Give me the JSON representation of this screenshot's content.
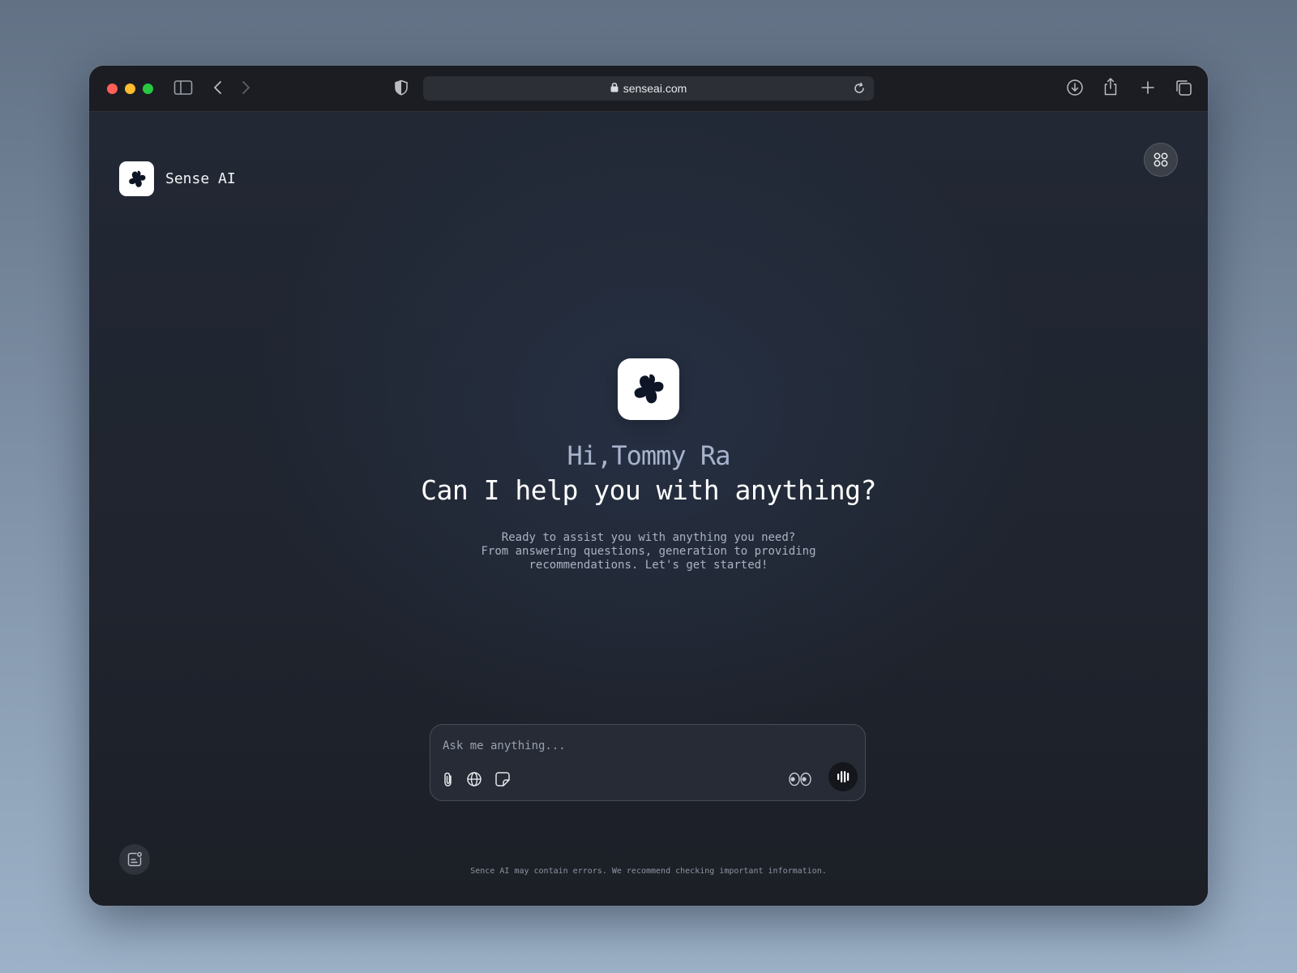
{
  "browser": {
    "url": "senseai.com",
    "icons": {
      "sidebar": "sidebar-icon",
      "back": "chevron-left-icon",
      "forward": "chevron-right-icon",
      "privacy": "shield-icon",
      "lock": "lock-icon",
      "reload": "reload-icon",
      "download": "download-icon",
      "share": "share-icon",
      "new_tab": "plus-icon",
      "tabs": "tabs-overview-icon"
    }
  },
  "app": {
    "brand_name": "Sense AI",
    "greeting_name": "Hi,Tommy Ra",
    "headline": "Can I help you with anything?",
    "subtext_lines": [
      "Ready to assist you with anything you need?",
      "From answering questions, generation to providing",
      "recommendations. Let's get started!"
    ],
    "composer": {
      "placeholder": "Ask me anything...",
      "icons": [
        "paperclip-icon",
        "globe-icon",
        "sticker-icon",
        "eyes-icon",
        "voice-wave-icon"
      ]
    },
    "disclaimer": "Sence AI may contain errors. We recommend checking important information."
  },
  "colors": {
    "background": "#202632",
    "accent_text": "#a7b3cc",
    "traffic_red": "#fe5f57",
    "traffic_yellow": "#febc2e",
    "traffic_green": "#28c840"
  }
}
